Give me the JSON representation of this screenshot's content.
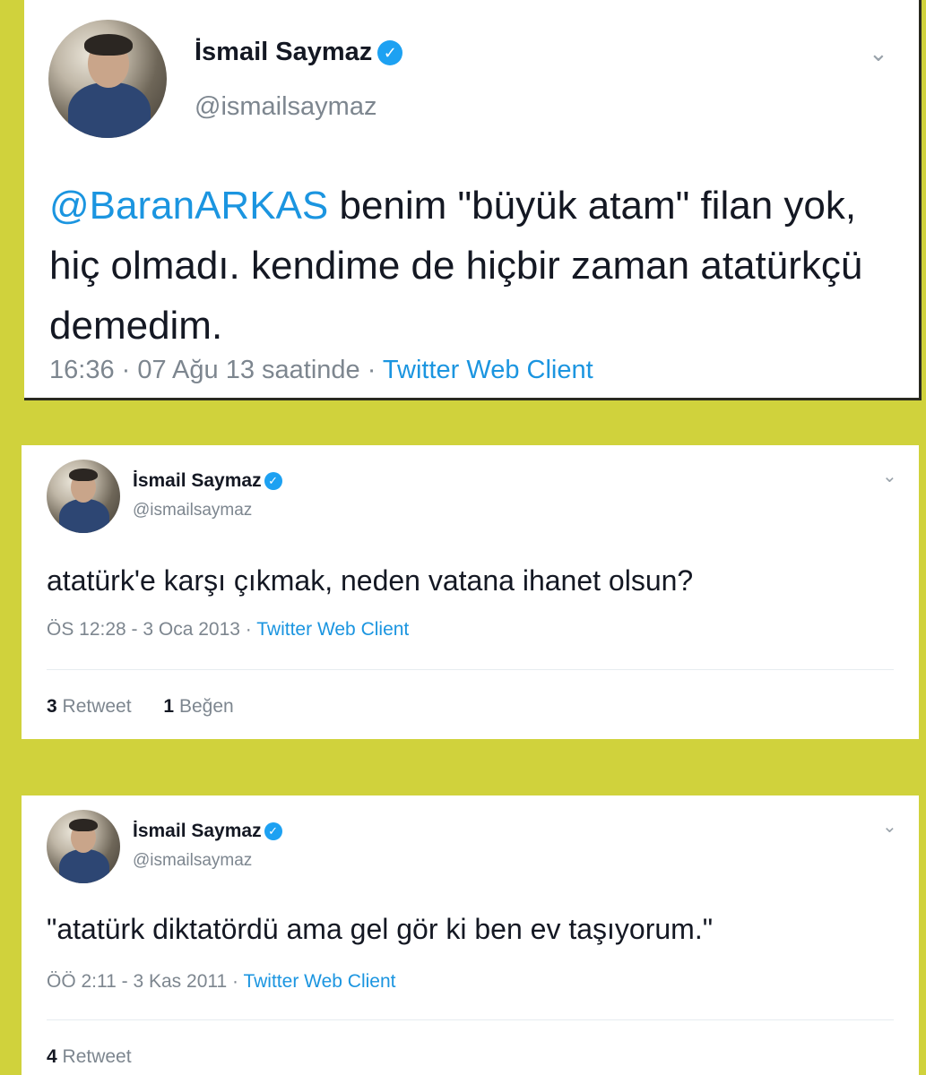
{
  "background_color": "#d0d23c",
  "accent_color": "#1b95e0",
  "tweets": [
    {
      "author_name": "İsmail Saymaz",
      "verified_icon": "verified-badge-icon",
      "handle": "@ismailsaymaz",
      "menu_icon": "chevron-down-icon",
      "mention": "@BaranARKAS",
      "text": " benim \"büyük atam\" filan yok, hiç olmadı. kendime de hiçbir zaman atatürkçü demedim.",
      "timestamp": "16:36 · 07 Ağu 13 saatinde · ",
      "client": "Twitter Web Client"
    },
    {
      "author_name": "İsmail Saymaz",
      "verified_icon": "verified-badge-icon",
      "handle": "@ismailsaymaz",
      "menu_icon": "chevron-down-icon",
      "text": "atatürk'e karşı çıkmak, neden vatana ihanet olsun?",
      "timestamp": "ÖS 12:28 - 3 Oca 2013 · ",
      "client": "Twitter Web Client",
      "retweet_count": "3",
      "retweet_label": "Retweet",
      "like_count": "1",
      "like_label": "Beğen"
    },
    {
      "author_name": "İsmail Saymaz",
      "verified_icon": "verified-badge-icon",
      "handle": "@ismailsaymaz",
      "menu_icon": "chevron-down-icon",
      "text": "\"atatürk diktatördü ama gel gör ki ben ev taşıyorum.\"",
      "timestamp": "ÖÖ 2:11 - 3 Kas 2011 · ",
      "client": "Twitter Web Client",
      "retweet_count": "4",
      "retweet_label": "Retweet"
    }
  ]
}
